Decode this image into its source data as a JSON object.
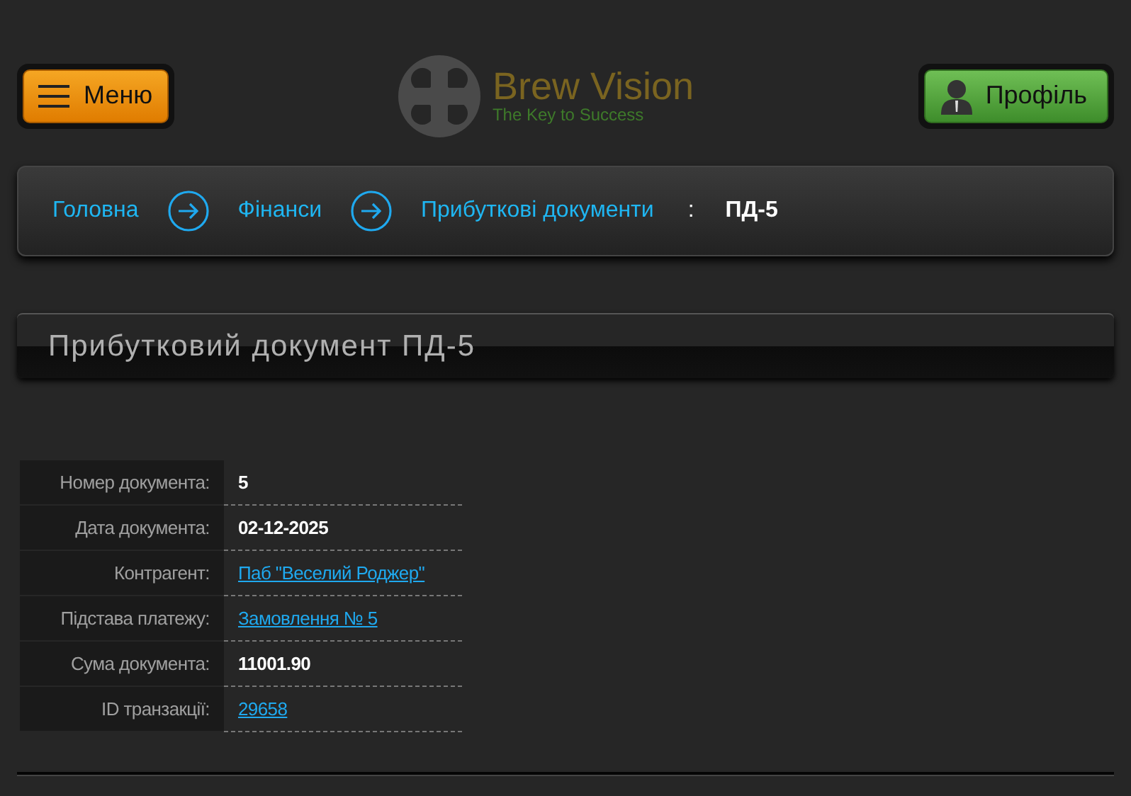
{
  "header": {
    "menu_button": "Меню",
    "logo": {
      "name": "Brew Vision",
      "tagline": "The Key to Success"
    },
    "profile_button": "Профіль"
  },
  "breadcrumb": {
    "links": [
      "Головна",
      "Фінанси",
      "Прибуткові документи"
    ],
    "separator": ":",
    "current": "ПД-5"
  },
  "title": "Прибутковий документ ПД-5",
  "details": [
    {
      "label": "Номер документа:",
      "value": "5",
      "kind": "text"
    },
    {
      "label": "Дата документа:",
      "value": "02-12-2025",
      "kind": "text"
    },
    {
      "label": "Контрагент:",
      "value": "Паб \"Веселий Роджер\"",
      "kind": "link"
    },
    {
      "label": "Підстава платежу:",
      "value": "Замовлення № 5",
      "kind": "link"
    },
    {
      "label": "Сума документа:",
      "value": "11001.90",
      "kind": "text"
    },
    {
      "label": "ID транзакції:",
      "value": "29658",
      "kind": "link"
    }
  ]
}
